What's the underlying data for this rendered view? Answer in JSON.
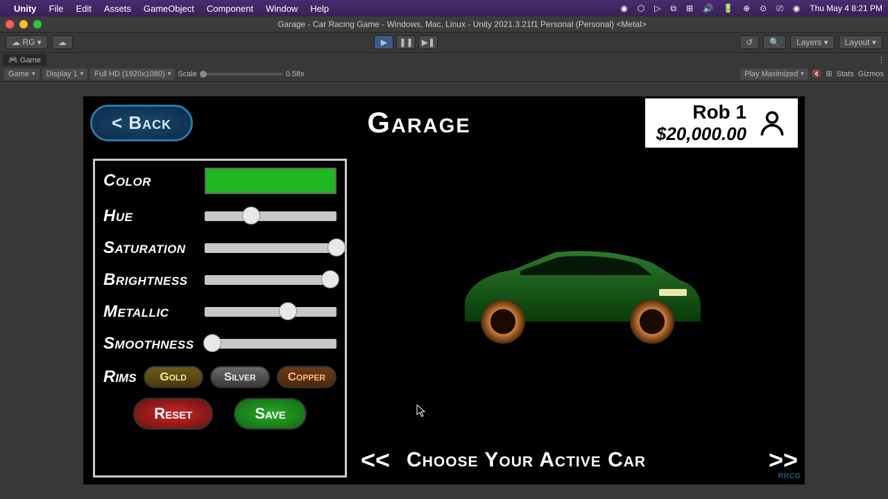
{
  "mac_menu": {
    "app": "Unity",
    "items": [
      "File",
      "Edit",
      "Assets",
      "GameObject",
      "Component",
      "Window",
      "Help"
    ],
    "clock": "Thu May 4  8:21 PM"
  },
  "window_title": "Garage - Car Racing Game - Windows, Mac, Linux - Unity 2021.3.21f1 Personal (Personal) <Metal>",
  "toolbar": {
    "account": "RG",
    "layers": "Layers",
    "layout": "Layout"
  },
  "game_tab": "Game",
  "game_controls": {
    "mode": "Game",
    "display": "Display 1",
    "resolution": "Full HD (1920x1080)",
    "scale_label": "Scale",
    "scale_value": "0.58x",
    "play_maximized": "Play Maximized",
    "stats": "Stats",
    "gizmos": "Gizmos"
  },
  "game_ui": {
    "back": "< Back",
    "title": "Garage",
    "player_name": "Rob 1",
    "player_money": "$20,000.00",
    "labels": {
      "color": "Color",
      "hue": "Hue",
      "saturation": "Saturation",
      "brightness": "Brightness",
      "metallic": "Metallic",
      "smoothness": "Smoothness",
      "rims": "Rims"
    },
    "sliders": {
      "hue": 0.35,
      "saturation": 1.0,
      "brightness": 0.95,
      "metallic": 0.63,
      "smoothness": 0.06
    },
    "color_swatch": "#1fb81f",
    "rims": {
      "gold": "Gold",
      "silver": "Silver",
      "copper": "Copper"
    },
    "reset": "Reset",
    "save": "Save",
    "choose": "Choose Your Active Car",
    "prev": "<<",
    "next": ">>"
  }
}
